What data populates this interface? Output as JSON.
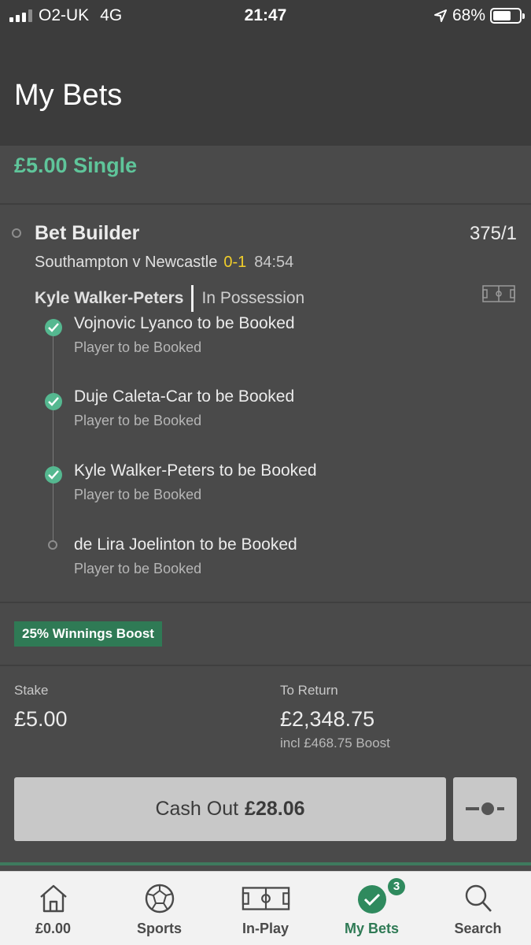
{
  "status_bar": {
    "carrier": "O2-UK",
    "network": "4G",
    "time": "21:47",
    "battery": "68%",
    "battery_level": 0.68
  },
  "header": {
    "title": "My Bets"
  },
  "bet": {
    "summary": "£5.00 Single",
    "title": "Bet Builder",
    "odds": "375/1",
    "match": "Southampton v Newcastle",
    "score": "0-1",
    "clock": "84:54",
    "player": "Kyle Walker-Peters",
    "player_status": "In Possession",
    "legs": [
      {
        "title": "Vojnovic Lyanco to be Booked",
        "subtitle": "Player to be Booked",
        "settled": true
      },
      {
        "title": "Duje Caleta-Car to be Booked",
        "subtitle": "Player to be Booked",
        "settled": true
      },
      {
        "title": "Kyle Walker-Peters to be Booked",
        "subtitle": "Player to be Booked",
        "settled": true
      },
      {
        "title": "de Lira Joelinton to be Booked",
        "subtitle": "Player to be Booked",
        "settled": false
      }
    ],
    "boost_badge": "25% Winnings Boost",
    "stake_label": "Stake",
    "stake_value": "£5.00",
    "return_label": "To Return",
    "return_value": "£2,348.75",
    "boost_note": "incl £468.75 Boost",
    "cashout_label": "Cash Out",
    "cashout_amount": "£28.06"
  },
  "nav": {
    "items": [
      {
        "label": "£0.00",
        "icon": "home-icon"
      },
      {
        "label": "Sports",
        "icon": "football-icon"
      },
      {
        "label": "In-Play",
        "icon": "pitch-icon"
      },
      {
        "label": "My Bets",
        "icon": "check-circle-icon",
        "badge": "3",
        "active": true
      },
      {
        "label": "Search",
        "icon": "search-icon"
      }
    ]
  },
  "colors": {
    "accent": "#5fc59a",
    "boost_bg": "#2f7a55",
    "score": "#f2cf2a"
  }
}
